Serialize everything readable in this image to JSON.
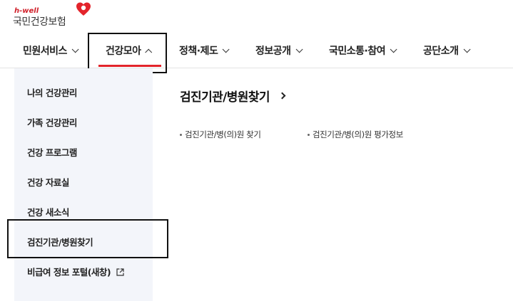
{
  "logo": {
    "tagline": "h-well",
    "name": "국민건강보험"
  },
  "gnb": {
    "items": [
      {
        "label": "민원서비스",
        "expanded": false
      },
      {
        "label": "건강모아",
        "expanded": true
      },
      {
        "label": "정책·제도",
        "expanded": false
      },
      {
        "label": "정보공개",
        "expanded": false
      },
      {
        "label": "국민소통·참여",
        "expanded": false
      },
      {
        "label": "공단소개",
        "expanded": false
      }
    ]
  },
  "lnb": {
    "items": [
      {
        "label": "나의 건강관리"
      },
      {
        "label": "가족 건강관리"
      },
      {
        "label": "건강 프로그램"
      },
      {
        "label": "건강 자료실"
      },
      {
        "label": "건강 새소식"
      },
      {
        "label": "검진기관/병원찾기",
        "selected": true
      },
      {
        "label": "비급여 정보 포털(새창)",
        "external": true
      }
    ]
  },
  "content": {
    "title": "검진기관/병원찾기",
    "links": [
      {
        "label": "검진기관/병(의)원 찾기"
      },
      {
        "label": "검진기관/병(의)원 평가정보"
      }
    ]
  },
  "colors": {
    "accent_red": "#e3242b",
    "lnb_bg": "#f3f5fa"
  }
}
